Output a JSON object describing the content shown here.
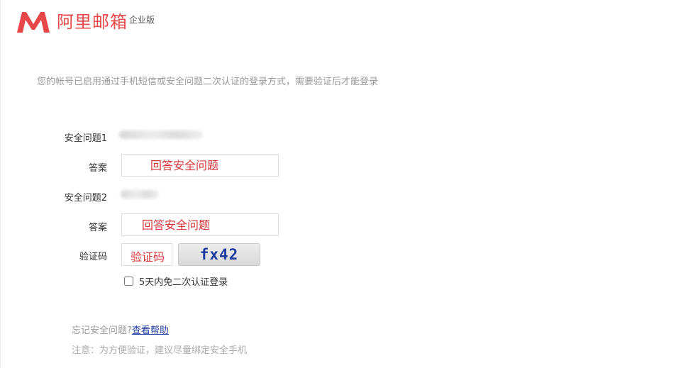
{
  "header": {
    "logo_text": "阿里邮箱",
    "edition": "企业版",
    "brand_color": "#e8474a"
  },
  "notice": "您的帐号已启用通过手机短信或安全问题二次认证的登录方式，需要验证后才能登录",
  "form": {
    "question1_label": "安全问题1",
    "answer1_label": "答案",
    "answer1_placeholder": "回答安全问题",
    "question2_label": "安全问题2",
    "answer2_label": "答案",
    "answer2_placeholder": "回答安全问题",
    "captcha_label": "验证码",
    "captcha_placeholder": "验证码",
    "captcha_text": "fx42",
    "remember_label": "5天内免二次认证登录",
    "remember_checked": false
  },
  "help": {
    "prefix": "忘记安全问题?",
    "link": "查看帮助"
  },
  "tip": "注意：为方便验证，建议尽量绑定安全手机"
}
